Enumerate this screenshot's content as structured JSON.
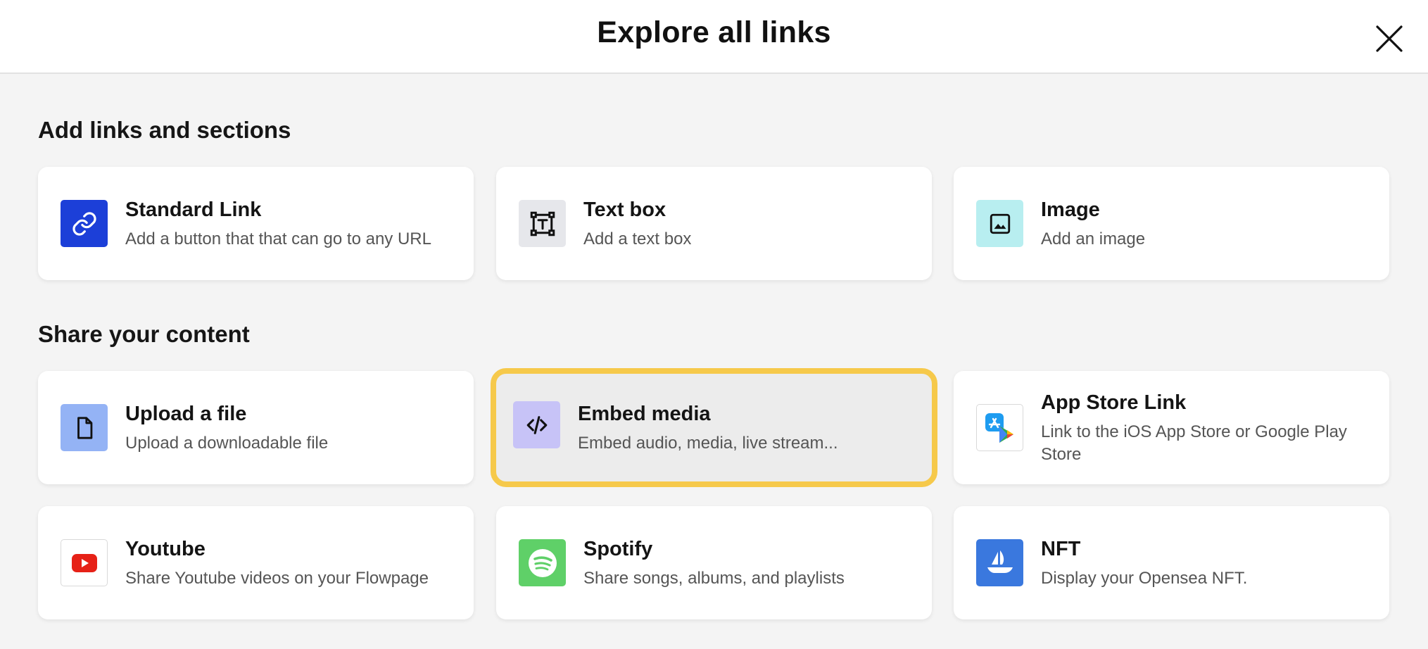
{
  "modal": {
    "title": "Explore all links",
    "close_icon": "close-icon"
  },
  "sections": {
    "add_links": {
      "heading": "Add links and sections",
      "items": [
        {
          "title": "Standard Link",
          "description": "Add a button that that can go to any URL",
          "icon": "link-icon",
          "icon_bg": "#1c3fd8"
        },
        {
          "title": "Text box",
          "description": "Add a text box",
          "icon": "text-box-icon",
          "icon_bg": "#e6e7eb"
        },
        {
          "title": "Image",
          "description": "Add an image",
          "icon": "image-icon",
          "icon_bg": "#b8eef0"
        }
      ]
    },
    "share_content": {
      "heading": "Share your content",
      "items": [
        {
          "title": "Upload a file",
          "description": "Upload a downloadable file",
          "icon": "file-icon",
          "icon_bg": "#94b3f5"
        },
        {
          "title": "Embed media",
          "description": "Embed audio, media, live stream...",
          "icon": "code-icon",
          "icon_bg": "#c7c3f7",
          "selected": true
        },
        {
          "title": "App Store Link",
          "description": "Link to the iOS App Store or Google Play Store",
          "icon": "app-store-icon",
          "icon_bg": "#ffffff"
        },
        {
          "title": "Youtube",
          "description": "Share Youtube videos on your Flowpage",
          "icon": "youtube-icon",
          "icon_bg": "#ffffff"
        },
        {
          "title": "Spotify",
          "description": "Share songs, albums, and playlists",
          "icon": "spotify-icon",
          "icon_bg": "#5fd068"
        },
        {
          "title": "NFT",
          "description": "Display your Opensea NFT.",
          "icon": "nft-boat-icon",
          "icon_bg": "#3a78de"
        }
      ]
    }
  },
  "colors": {
    "selection_border": "#f6c94b",
    "page_background": "#f4f4f4"
  }
}
